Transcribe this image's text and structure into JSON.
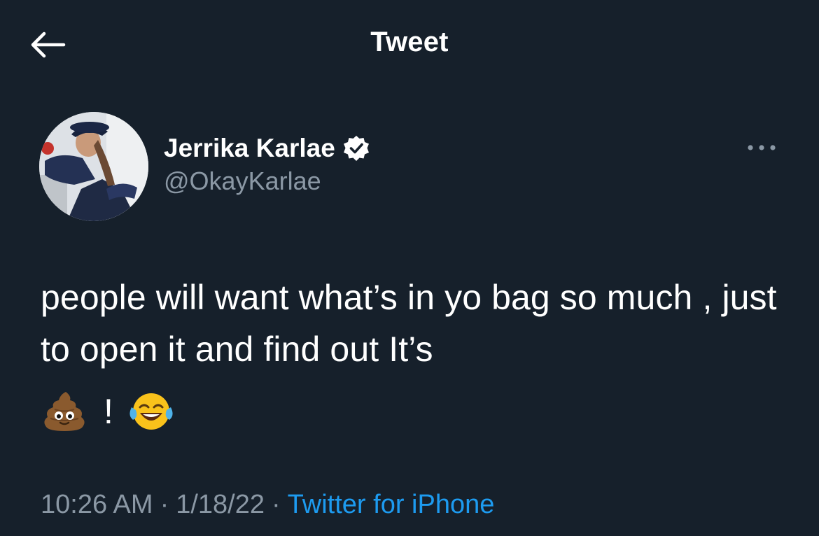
{
  "header": {
    "title": "Tweet",
    "back_icon": "arrow-left-icon"
  },
  "author": {
    "display_name": "Jerrika Karlae",
    "handle": "@OkayKarlae",
    "verified_icon": "verified-badge-icon"
  },
  "tweet": {
    "text": "people will want what’s in yo bag so much , just to open it and find out It’s",
    "exclamation": "!",
    "emoji_icons": [
      "pile-of-poo-emoji-icon",
      "face-with-tears-of-joy-emoji-icon"
    ]
  },
  "meta": {
    "time": "10:26 AM",
    "separator": "·",
    "date": "1/18/22",
    "source": "Twitter for iPhone"
  },
  "colors": {
    "background": "#16202b",
    "text_primary": "#ffffff",
    "text_secondary": "#8b98a5",
    "link": "#1d9bf0"
  }
}
